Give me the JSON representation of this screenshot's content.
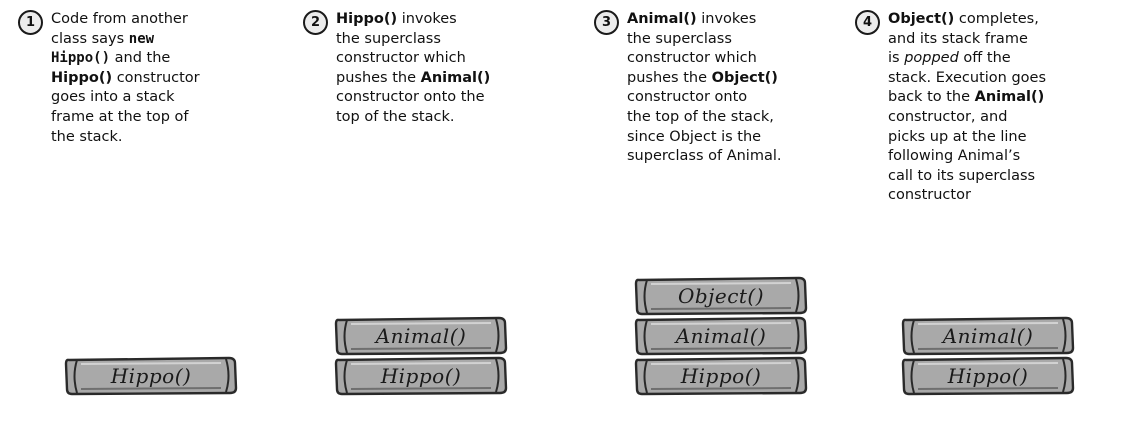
{
  "steps": [
    {
      "number": "1",
      "lines": [
        [
          {
            "text": "Code from another"
          }
        ],
        [
          {
            "text": "class says "
          },
          {
            "text": "new",
            "style": "mono"
          }
        ],
        [
          {
            "text": "Hippo()",
            "style": "mono"
          },
          {
            "text": " and the"
          }
        ],
        [
          {
            "text": "Hippo()",
            "style": "bold"
          },
          {
            "text": " constructor"
          }
        ],
        [
          {
            "text": "goes into a stack"
          }
        ],
        [
          {
            "text": "frame at the top of"
          }
        ],
        [
          {
            "text": "the stack."
          }
        ]
      ],
      "frames": [
        "Hippo()"
      ]
    },
    {
      "number": "2",
      "lines": [
        [
          {
            "text": "Hippo()",
            "style": "bold"
          },
          {
            "text": " invokes"
          }
        ],
        [
          {
            "text": "the superclass"
          }
        ],
        [
          {
            "text": "constructor which"
          }
        ],
        [
          {
            "text": "pushes the "
          },
          {
            "text": "Animal()",
            "style": "bold"
          }
        ],
        [
          {
            "text": "constructor  onto the"
          }
        ],
        [
          {
            "text": "top of the stack."
          }
        ]
      ],
      "frames": [
        "Animal()",
        "Hippo()"
      ]
    },
    {
      "number": "3",
      "lines": [
        [
          {
            "text": "Animal()",
            "style": "bold"
          },
          {
            "text": " invokes"
          }
        ],
        [
          {
            "text": "the superclass"
          }
        ],
        [
          {
            "text": "constructor which"
          }
        ],
        [
          {
            "text": "pushes the "
          },
          {
            "text": "Object()",
            "style": "bold"
          }
        ],
        [
          {
            "text": "constructor  onto"
          }
        ],
        [
          {
            "text": "the top of the stack,"
          }
        ],
        [
          {
            "text": "since Object is the"
          }
        ],
        [
          {
            "text": "superclass of Animal."
          }
        ]
      ],
      "frames": [
        "Object()",
        "Animal()",
        "Hippo()"
      ]
    },
    {
      "number": "4",
      "lines": [
        [
          {
            "text": "Object()",
            "style": "bold"
          },
          {
            "text": " completes,"
          }
        ],
        [
          {
            "text": "and its stack frame"
          }
        ],
        [
          {
            "text": "is "
          },
          {
            "text": "popped",
            "style": "ital"
          },
          {
            "text": " off the"
          }
        ],
        [
          {
            "text": "stack. Execution goes"
          }
        ],
        [
          {
            "text": "back to the "
          },
          {
            "text": "Animal()",
            "style": "bold"
          }
        ],
        [
          {
            "text": "constructor, and"
          }
        ],
        [
          {
            "text": "picks up at the line"
          }
        ],
        [
          {
            "text": "following Animal’s"
          }
        ],
        [
          {
            "text": "call to its superclass"
          }
        ],
        [
          {
            "text": "constructor"
          }
        ]
      ],
      "frames": [
        "Animal()",
        "Hippo()"
      ]
    }
  ],
  "colors": {
    "frame_fill": "#a9a9a9",
    "frame_edge": "#2a2a2a",
    "badge_fill": "#ececec"
  },
  "icons": {
    "frame_shape": "rounded-cylinder-block"
  }
}
